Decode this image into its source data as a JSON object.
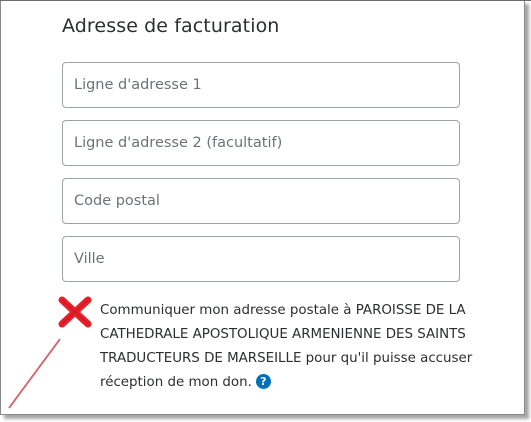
{
  "billing": {
    "title": "Adresse de facturation",
    "address_line1_placeholder": "Ligne d'adresse 1",
    "address_line2_placeholder": "Ligne d'adresse 2 (facultatif)",
    "postal_code_placeholder": "Code postal",
    "city_placeholder": "Ville",
    "address_line1_value": "",
    "address_line2_value": "",
    "postal_code_value": "",
    "city_value": ""
  },
  "consent": {
    "checked": false,
    "text": "Communiquer mon adresse postale à PAROISSE DE LA CATHEDRALE APOSTOLIQUE ARMENIENNE DES SAINTS TRADUCTEURS DE MARSEILLE pour qu'il puisse accuser réception de mon don.",
    "help_icon_glyph": "?",
    "help_icon": "question-circle-icon"
  },
  "annotation": {
    "mark_icon": "red-cross-icon",
    "mark_color": "#e8202a",
    "line_color": "#c8202a"
  },
  "colors": {
    "accent": "#0070ba",
    "text": "#2c2e2f",
    "field_border": "#9da3a6"
  }
}
